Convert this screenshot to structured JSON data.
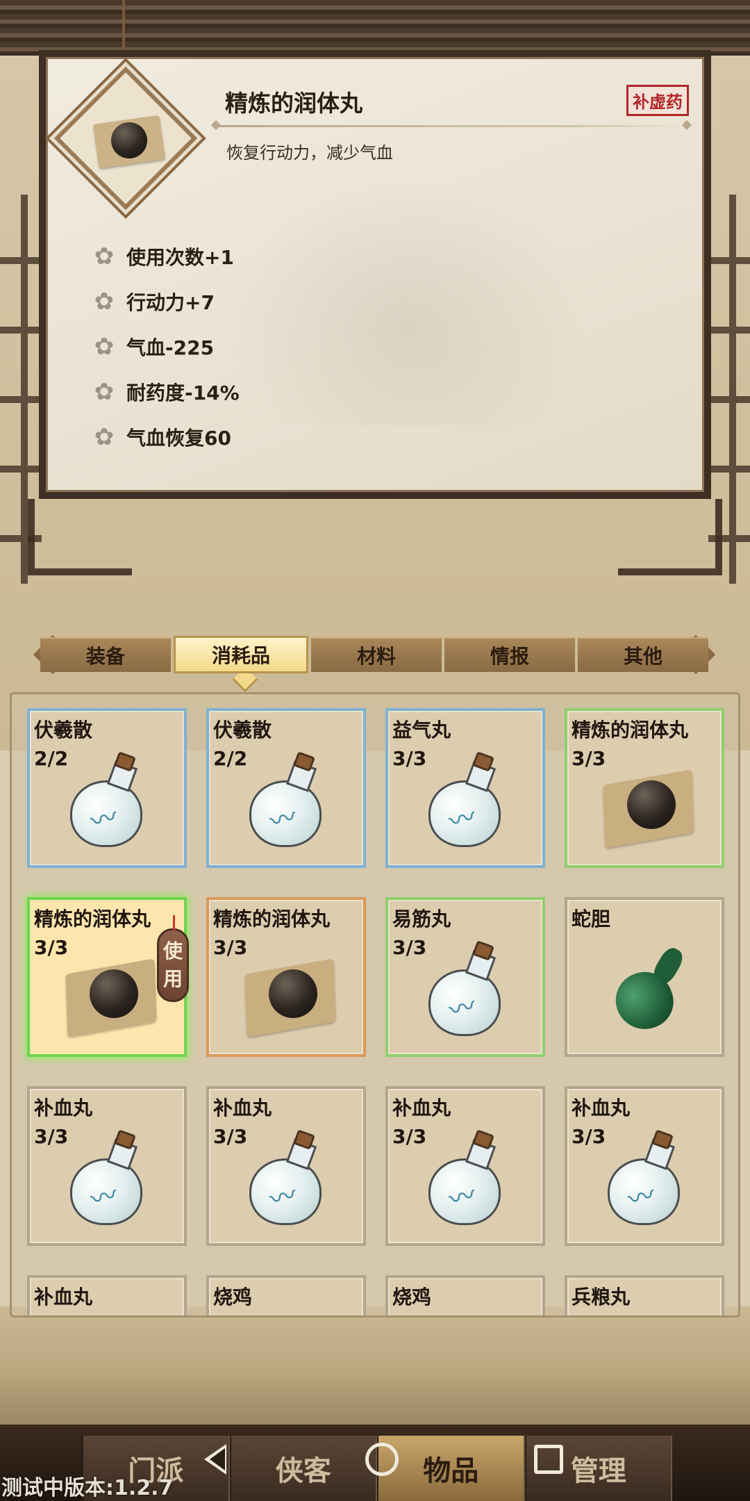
{
  "detail": {
    "name": "精炼的润体丸",
    "tag": "补虚药",
    "description": "恢复行动力，减少气血",
    "stats": [
      "使用次数+1",
      "行动力+7",
      "气血-225",
      "耐药度-14%",
      "气血恢复60"
    ]
  },
  "tabs": [
    "装备",
    "消耗品",
    "材料",
    "情报",
    "其他"
  ],
  "active_tab": "消耗品",
  "use_button": {
    "line1": "使",
    "line2": "用"
  },
  "items": [
    {
      "name": "伏羲散",
      "count": "2/2",
      "icon": "bottle-icon",
      "rarity": "blue"
    },
    {
      "name": "伏羲散",
      "count": "2/2",
      "icon": "bottle-icon",
      "rarity": "blue"
    },
    {
      "name": "益气丸",
      "count": "3/3",
      "icon": "bottle-icon",
      "rarity": "blue"
    },
    {
      "name": "精炼的润体丸",
      "count": "3/3",
      "icon": "pill-icon",
      "rarity": "green"
    },
    {
      "name": "精炼的润体丸",
      "count": "3/3",
      "icon": "pill-icon",
      "rarity": "green",
      "selected": true
    },
    {
      "name": "精炼的润体丸",
      "count": "3/3",
      "icon": "pill-icon",
      "rarity": "orange"
    },
    {
      "name": "易筋丸",
      "count": "3/3",
      "icon": "bottle-icon",
      "rarity": "green"
    },
    {
      "name": "蛇胆",
      "count": "",
      "icon": "gourd-icon",
      "rarity": "gray"
    },
    {
      "name": "补血丸",
      "count": "3/3",
      "icon": "bottle-icon",
      "rarity": "gray"
    },
    {
      "name": "补血丸",
      "count": "3/3",
      "icon": "bottle-icon",
      "rarity": "gray"
    },
    {
      "name": "补血丸",
      "count": "3/3",
      "icon": "bottle-icon",
      "rarity": "gray"
    },
    {
      "name": "补血丸",
      "count": "3/3",
      "icon": "bottle-icon",
      "rarity": "gray"
    },
    {
      "name": "补血丸",
      "count": "",
      "icon": "bottle-icon",
      "rarity": "gray"
    },
    {
      "name": "烧鸡",
      "count": "",
      "icon": "",
      "rarity": "gray"
    },
    {
      "name": "烧鸡",
      "count": "",
      "icon": "",
      "rarity": "gray"
    },
    {
      "name": "兵粮丸",
      "count": "",
      "icon": "",
      "rarity": "gray"
    }
  ],
  "nav": [
    "门派",
    "侠客",
    "物品",
    "管理"
  ],
  "active_nav": "物品",
  "version": "测试中版本:1.2.7"
}
